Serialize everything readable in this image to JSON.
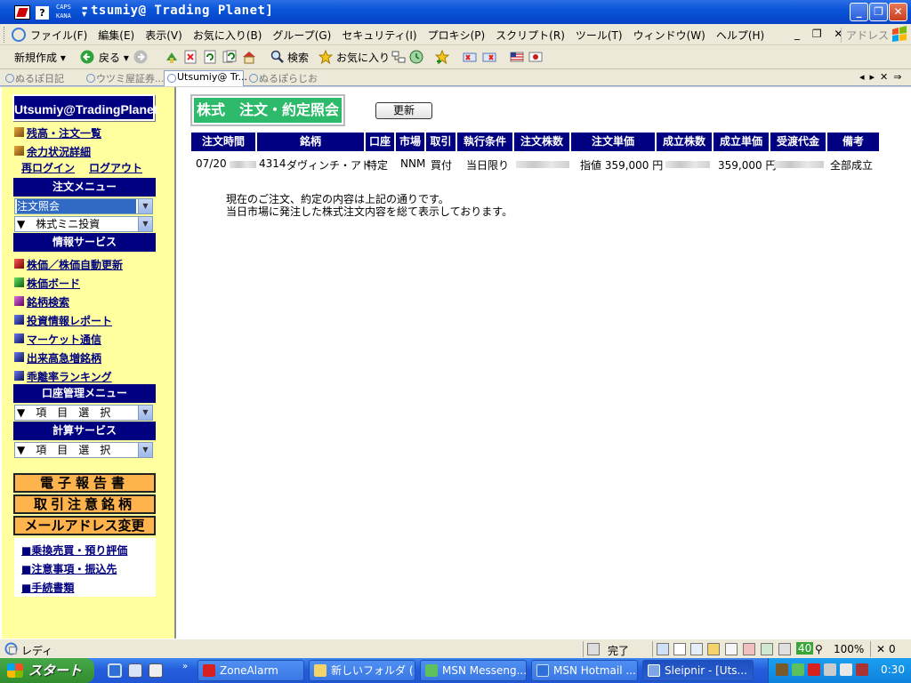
{
  "window": {
    "title": "tsumiy@ Trading Planet]",
    "caps": "CAPS",
    "kana": "KANA"
  },
  "menubar": {
    "items": [
      "ファイル(F)",
      "編集(E)",
      "表示(V)",
      "お気に入り(B)",
      "グループ(G)",
      "セキュリティ(I)",
      "プロキシ(P)",
      "スクリプト(R)",
      "ツール(T)",
      "ウィンドウ(W)",
      "ヘルプ(H)"
    ],
    "address_label": "アドレス"
  },
  "toolbar": {
    "new_label": "新規作成",
    "back_label": "戻る",
    "search_label": "検索",
    "favorites_label": "お気に入り"
  },
  "tabs": [
    {
      "label": "ぬるぽ日記"
    },
    {
      "label": "ウツミ屋証券..."
    },
    {
      "label": "Utsumiy@ Tr..."
    },
    {
      "label": "ぬるぽらじお"
    }
  ],
  "sidebar": {
    "brand": "Utsumiy@TradingPlanet",
    "links_top": [
      "残高・注文一覧",
      "余力状況詳細"
    ],
    "relogin": "再ログイン",
    "logout": "ログアウト",
    "order_menu_header": "注文メニュー",
    "order_select_value": "注文照会",
    "mini_select_value": "▼　株式ミニ投資",
    "info_header": "情報サービス",
    "info_links": [
      "株価／株価自動更新",
      "株価ボード",
      "銘柄検索",
      "投資情報レポート",
      "マーケット通信",
      "出来高急増銘柄",
      "乖離率ランキング"
    ],
    "account_header": "口座管理メニュー",
    "account_select_value": "▼　項　目　選　択",
    "calc_header": "計算サービス",
    "calc_select_value": "▼　項　目　選　択",
    "big_buttons": [
      "電子報告書",
      "取引注意銘柄",
      "メールアドレス変更"
    ],
    "bottom_links": [
      "■乗換売買・預り評価",
      "■注意事項・振込先",
      "■手続書類"
    ]
  },
  "main": {
    "heading": "株式　注文・約定照会",
    "refresh_label": "更新",
    "table": {
      "headers": [
        "注文時間",
        "銘柄",
        "口座",
        "市場",
        "取引",
        "執行条件",
        "注文株数",
        "注文単価",
        "成立株数",
        "成立単価",
        "受渡代金",
        "備考"
      ],
      "row": {
        "time": "07/20",
        "code": "4314",
        "name": "ダヴィンチ・アド",
        "account": "特定",
        "market": "NNM",
        "trade": "買付",
        "condition": "当日限り",
        "order_price": "指値 359,000 円",
        "exec_price": "359,000 円",
        "remark": "全部成立"
      }
    },
    "notes": [
      "現在のご注文、約定の内容は上記の通りです。",
      "当日市場に発注した株式注文内容を総て表示しております。"
    ]
  },
  "statusbar": {
    "ready": "レディ",
    "done": "完了",
    "counter": "40",
    "zoom": "100%",
    "close_count": "0"
  },
  "taskbar": {
    "start": "スタート",
    "tasks": [
      "ZoneAlarm",
      "新しいフォルダ (...",
      "MSN Messeng...",
      "MSN Hotmail ...",
      "Sleipnir - [Uts..."
    ],
    "clock": "0:30"
  },
  "colors": {
    "nav_header": "#000080",
    "sidebar_bg": "#ffffa0",
    "heading_green": "#2dba6a",
    "big_button": "#ffb34d",
    "link": "#00007f"
  }
}
